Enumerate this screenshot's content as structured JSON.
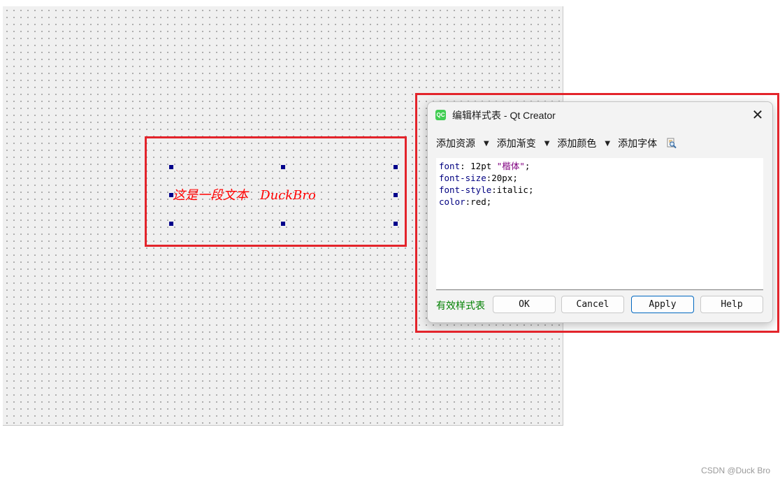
{
  "canvas": {
    "label_text": "这是一段文本   DuckBro"
  },
  "dialog": {
    "title": "编辑样式表 - Qt Creator",
    "app_icon_text": "QC",
    "close_symbol": "✕",
    "toolbar": {
      "items": [
        {
          "label": "添加资源",
          "has_dropdown": true
        },
        {
          "label": "添加渐变",
          "has_dropdown": true
        },
        {
          "label": "添加颜色",
          "has_dropdown": true
        },
        {
          "label": "添加字体",
          "has_dropdown": false
        }
      ],
      "dropdown_arrow": "▼",
      "icon": "font-preview-icon"
    },
    "editor": {
      "lines": [
        {
          "prop": "font",
          "rest": ": 12pt ",
          "str": "\"楷体\"",
          "end": ";"
        },
        {
          "prop": "font-size",
          "rest": ":20px;",
          "str": "",
          "end": ""
        },
        {
          "prop": "font-style",
          "rest": ":italic;",
          "str": "",
          "end": ""
        },
        {
          "prop": "color",
          "rest": ":red;",
          "str": "",
          "end": ""
        }
      ]
    },
    "footer": {
      "status": "有效样式表",
      "status_color": "#008000",
      "buttons": {
        "ok": "OK",
        "cancel": "Cancel",
        "apply": "Apply",
        "help": "Help"
      }
    }
  },
  "watermark": "CSDN @Duck Bro",
  "colors": {
    "highlight_box": "#e3242b",
    "handle": "#00008b",
    "label_text": "#ff0000",
    "code_keyword": "#000080",
    "code_string": "#800080"
  }
}
